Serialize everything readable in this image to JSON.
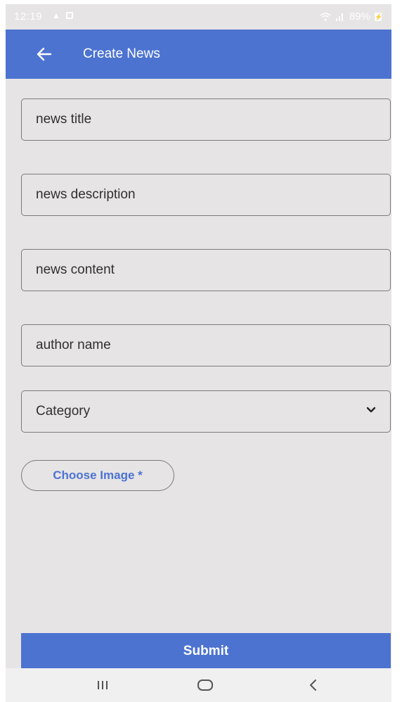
{
  "status_bar": {
    "time": "12:19",
    "battery": "89%"
  },
  "app_bar": {
    "title": "Create News"
  },
  "form": {
    "title_placeholder": "news title",
    "description_placeholder": "news description",
    "content_placeholder": "news content",
    "author_placeholder": "author name",
    "category_label": "Category",
    "choose_image_label": "Choose Image *",
    "submit_label": "Submit"
  },
  "colors": {
    "primary": "#4c73d0",
    "background": "#e6e4e5"
  },
  "icons": {
    "back": "arrow-left-icon",
    "dropdown": "chevron-down-icon",
    "nav_recents": "recent-apps-icon",
    "nav_home": "home-icon",
    "nav_back": "nav-back-icon"
  }
}
